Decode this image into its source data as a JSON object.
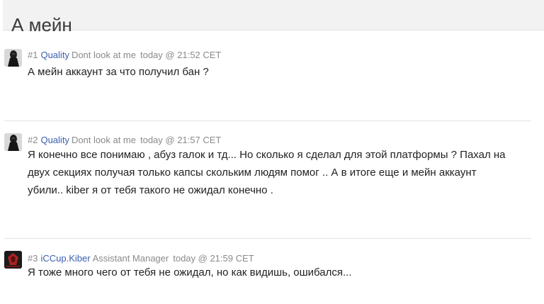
{
  "topic": {
    "title": "А мейн"
  },
  "posts": [
    {
      "number": "#1",
      "author": "Quality",
      "user_title": "Dont look at me",
      "time": "today @ 21:52 CET",
      "avatar_icon": "dark-figure-avatar-icon",
      "body": "А мейн аккаунт за что получил бан ?"
    },
    {
      "number": "#2",
      "author": "Quality",
      "user_title": "Dont look at me",
      "time": "today @ 21:57 CET",
      "avatar_icon": "dark-figure-avatar-icon",
      "body_lines": [
        "Я конечно все понимаю , абуз галок и тд... Но сколько я сделал для этой платформы ? Пахал на",
        "двух секциях получая только капсы скольким людям помог .. А в итоге еще и мейн аккаунт",
        "убили.. kiber я от тебя такого не ожидал конечно ."
      ]
    },
    {
      "number": "#3",
      "author": "iCCup.Kiber",
      "user_title": "Assistant Manager",
      "time": "today @ 21:59 CET",
      "avatar_icon": "red-emblem-avatar-icon",
      "body": "Я тоже много чего от тебя не ожидал, но как видишь, ошибался..."
    }
  ],
  "colors": {
    "author_link": "#3a5fb0",
    "meta_gray": "#8a8a8a",
    "header_bg": "#f2f2f2"
  }
}
